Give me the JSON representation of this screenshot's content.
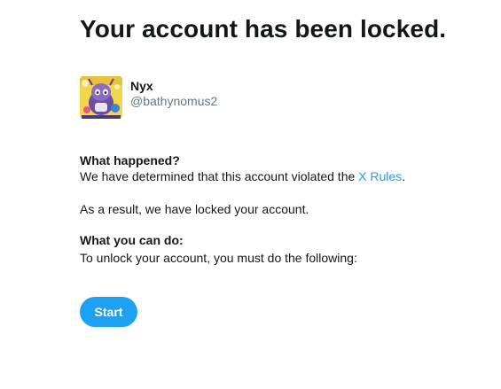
{
  "heading": "Your account has been locked.",
  "profile": {
    "display_name": "Nyx",
    "handle": "@bathynomus2"
  },
  "what_happened": {
    "title": "What happened?",
    "text_before_link": "We have determined that this account violated the ",
    "link_text": "X Rules",
    "text_after_link": "."
  },
  "result_text": "As a result, we have locked your account.",
  "what_you_can_do": {
    "title": "What you can do:",
    "text": "To unlock your account, you must do the following:"
  },
  "start_button_label": "Start",
  "colors": {
    "accent": "#1da1f2",
    "text": "#14171a",
    "secondary_text": "#657786"
  }
}
